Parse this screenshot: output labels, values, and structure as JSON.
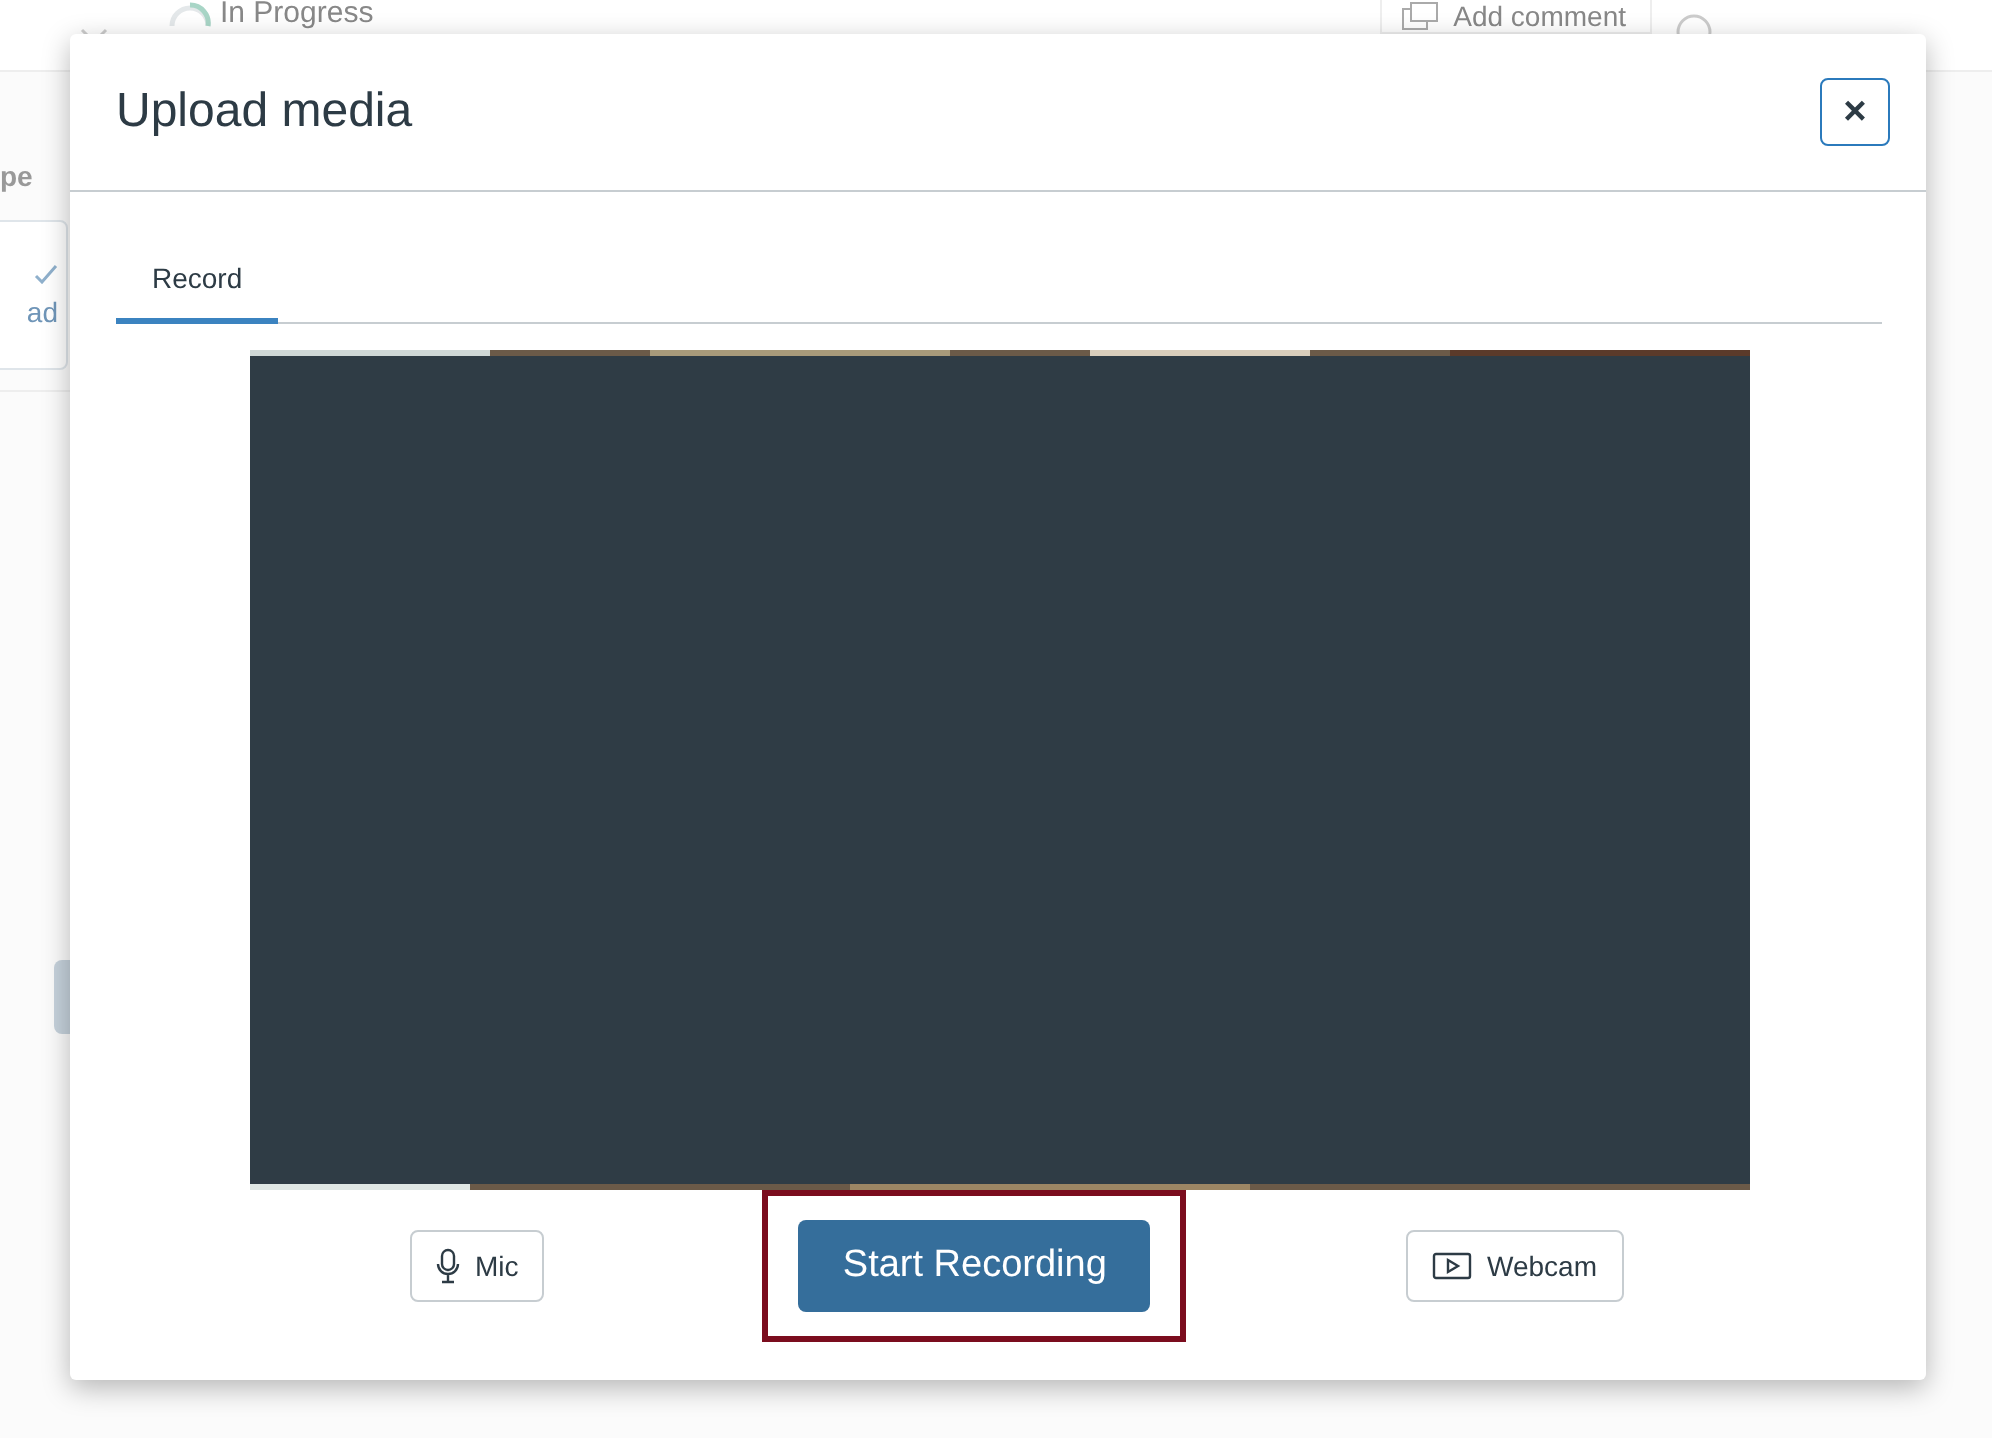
{
  "background": {
    "status": "In Progress",
    "comment_button": "Add comment",
    "column_heading_fragment": "pe",
    "upload_button_fragment": "ad"
  },
  "dialog": {
    "title": "Upload media",
    "close_label": "×",
    "tabs": [
      {
        "label": "Record",
        "selected": true
      }
    ],
    "controls": [
      {
        "kind": "mic",
        "label": "Mic",
        "highlighted": false
      },
      {
        "kind": "primary",
        "label": "Start Recording",
        "highlighted": true
      },
      {
        "kind": "webcam",
        "label": "Webcam",
        "highlighted": false
      }
    ]
  }
}
